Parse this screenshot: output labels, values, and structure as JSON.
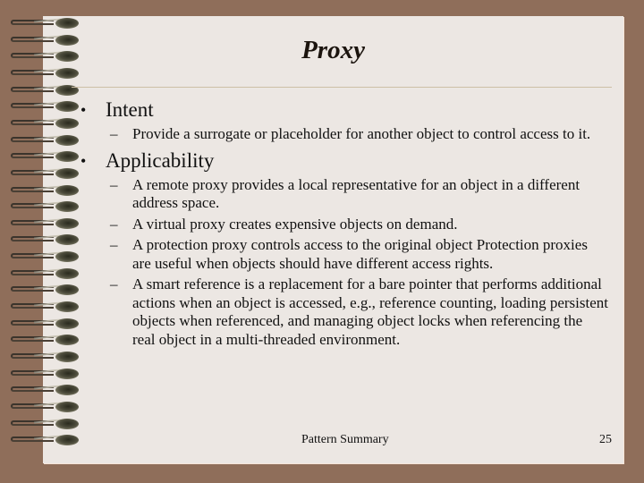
{
  "slide": {
    "title": "Proxy",
    "sections": [
      {
        "heading": "Intent",
        "bullet": "•",
        "items": [
          {
            "dash": "–",
            "text": "Provide a surrogate or placeholder for another object to control access to it."
          }
        ]
      },
      {
        "heading": "Applicability",
        "bullet": "•",
        "items": [
          {
            "dash": "–",
            "text": "A remote proxy provides a local representative for an object in a different address space."
          },
          {
            "dash": "–",
            "text": "A virtual proxy creates expensive objects on demand."
          },
          {
            "dash": "–",
            "text": "A protection proxy controls access to the original object Protection proxies are useful when objects should have different access rights."
          },
          {
            "dash": "–",
            "text": "A smart reference is a replacement for a bare pointer that performs additional actions when an object is accessed, e.g., reference counting, loading persistent objects when referenced, and managing object locks when referencing the real object in a multi-threaded environment."
          }
        ]
      }
    ],
    "footer": "Pattern Summary",
    "page_number": "25"
  },
  "decor": {
    "spiral_ring_count": 26,
    "background_color": "#8f6e5a",
    "page_color": "#ece7e3",
    "rule_color": "#cdbfa6"
  }
}
